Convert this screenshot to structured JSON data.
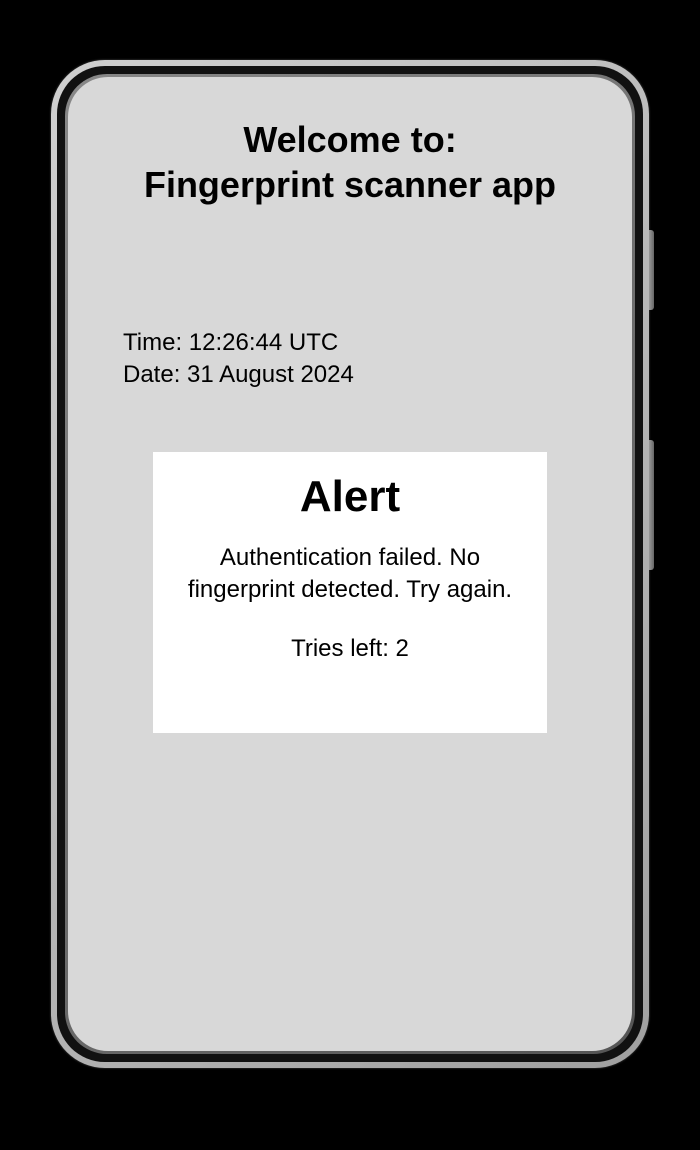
{
  "header": {
    "title_line1": "Welcome to:",
    "title_line2": "Fingerprint scanner app"
  },
  "meta": {
    "time_label": "Time: ",
    "time_value": "12:26:44 UTC",
    "date_label": "Date: ",
    "date_value": "31 August 2024"
  },
  "alert": {
    "title": "Alert",
    "message": "Authentication failed. No fingerprint detected. Try again.",
    "tries_label": "Tries left: ",
    "tries_value": "2"
  }
}
